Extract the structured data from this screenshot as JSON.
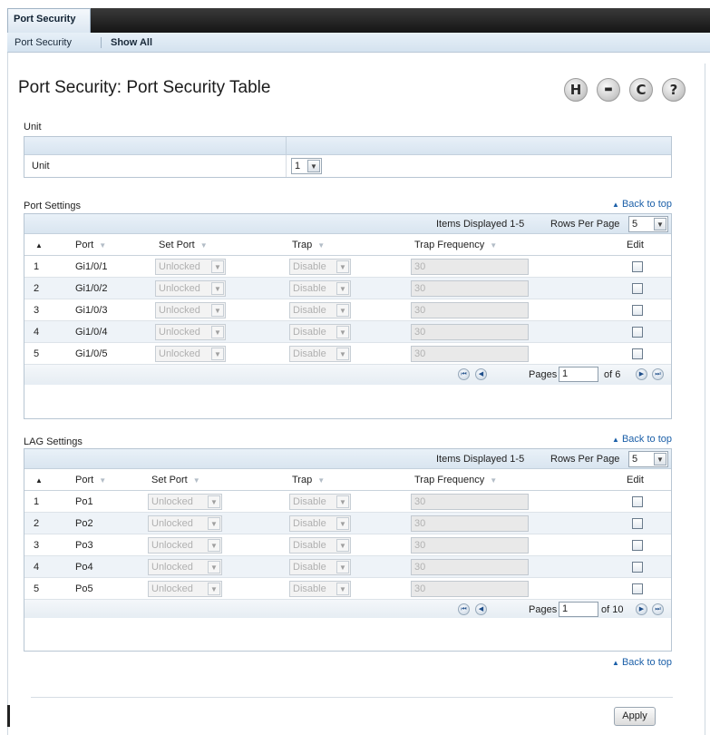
{
  "top_tab": "Port Security",
  "subnav": {
    "items": [
      "Port Security",
      "Show All"
    ]
  },
  "page_title": "Port Security: Port Security Table",
  "toolbar_icons": [
    {
      "name": "save-icon",
      "glyph": "H"
    },
    {
      "name": "print-icon",
      "glyph": "▬"
    },
    {
      "name": "refresh-icon",
      "glyph": "C"
    },
    {
      "name": "help-icon",
      "glyph": "?"
    }
  ],
  "unit_section": {
    "label": "Unit",
    "row_label": "Unit",
    "unit_value": "1"
  },
  "back_to_top": "Back to top",
  "columns": {
    "port": "Port",
    "set_port": "Set Port",
    "trap": "Trap",
    "trap_frequency": "Trap Frequency",
    "edit": "Edit"
  },
  "port_settings": {
    "label": "Port Settings",
    "items_displayed": "Items Displayed 1-5",
    "rows_per_page_label": "Rows Per Page",
    "rows_per_page": "5",
    "rows": [
      {
        "index": "1",
        "port": "Gi1/0/1",
        "set_port": "Unlocked",
        "trap": "Disable",
        "trap_frequency": "30"
      },
      {
        "index": "2",
        "port": "Gi1/0/2",
        "set_port": "Unlocked",
        "trap": "Disable",
        "trap_frequency": "30"
      },
      {
        "index": "3",
        "port": "Gi1/0/3",
        "set_port": "Unlocked",
        "trap": "Disable",
        "trap_frequency": "30"
      },
      {
        "index": "4",
        "port": "Gi1/0/4",
        "set_port": "Unlocked",
        "trap": "Disable",
        "trap_frequency": "30"
      },
      {
        "index": "5",
        "port": "Gi1/0/5",
        "set_port": "Unlocked",
        "trap": "Disable",
        "trap_frequency": "30"
      }
    ],
    "pages_label": "Pages",
    "page": "1",
    "of_label": "of 6"
  },
  "lag_settings": {
    "label": "LAG Settings",
    "items_displayed": "Items Displayed 1-5",
    "rows_per_page_label": "Rows Per Page",
    "rows_per_page": "5",
    "rows": [
      {
        "index": "1",
        "port": "Po1",
        "set_port": "Unlocked",
        "trap": "Disable",
        "trap_frequency": "30"
      },
      {
        "index": "2",
        "port": "Po2",
        "set_port": "Unlocked",
        "trap": "Disable",
        "trap_frequency": "30"
      },
      {
        "index": "3",
        "port": "Po3",
        "set_port": "Unlocked",
        "trap": "Disable",
        "trap_frequency": "30"
      },
      {
        "index": "4",
        "port": "Po4",
        "set_port": "Unlocked",
        "trap": "Disable",
        "trap_frequency": "30"
      },
      {
        "index": "5",
        "port": "Po5",
        "set_port": "Unlocked",
        "trap": "Disable",
        "trap_frequency": "30"
      }
    ],
    "pages_label": "Pages",
    "page": "1",
    "of_label": "of 10"
  },
  "apply_label": "Apply"
}
